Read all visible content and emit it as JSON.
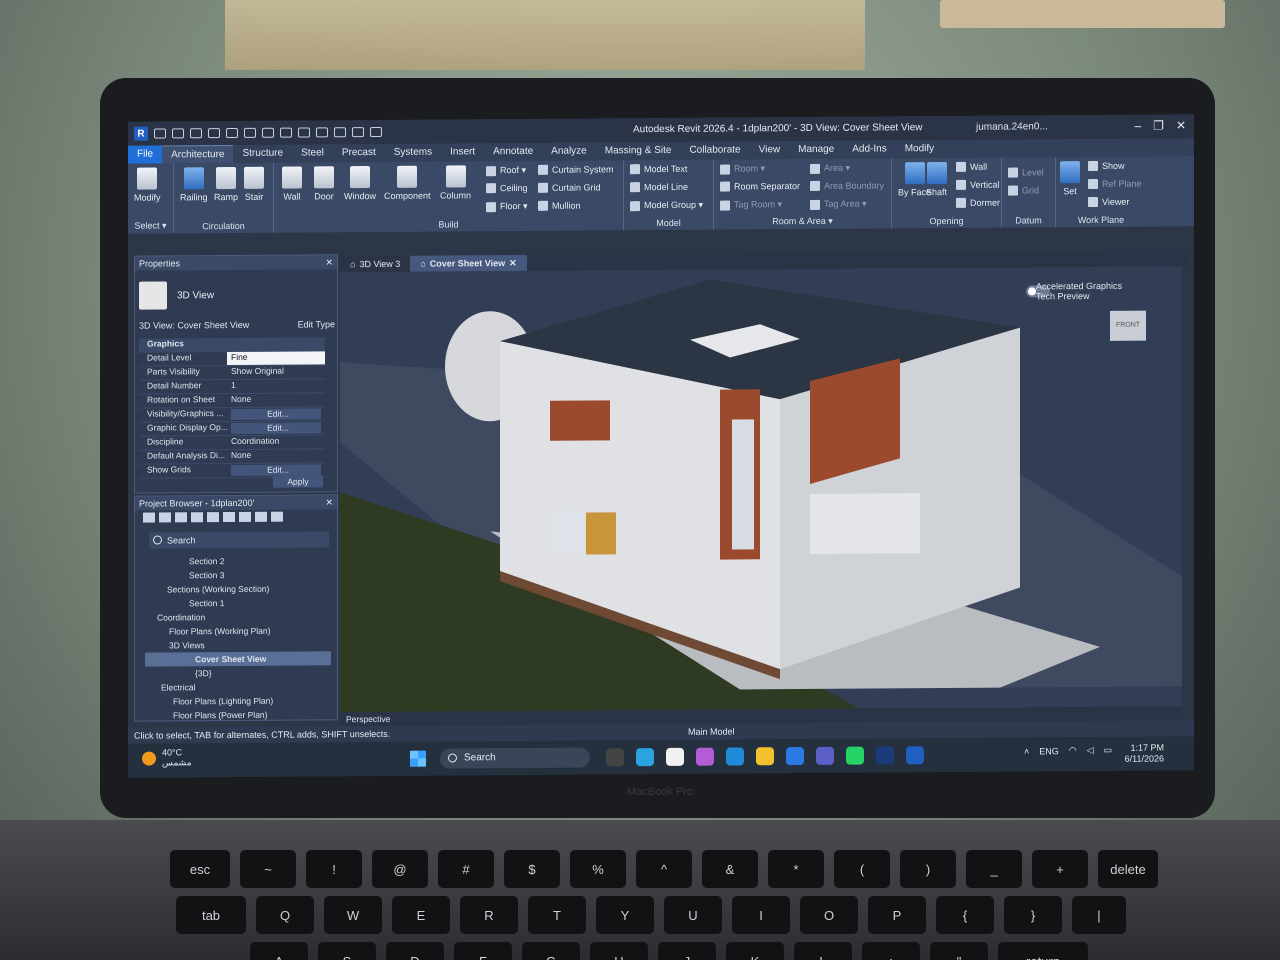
{
  "window": {
    "title": "Autodesk Revit 2026.4 - 1dplan200' - 3D View: Cover Sheet View",
    "user": "jumana.24en0...",
    "min": "–",
    "max": "❐",
    "close": "✕"
  },
  "ribbon_tabs": [
    "File",
    "Architecture",
    "Structure",
    "Steel",
    "Precast",
    "Systems",
    "Insert",
    "Annotate",
    "Analyze",
    "Massing & Site",
    "Collaborate",
    "View",
    "Manage",
    "Add-Ins",
    "Modify"
  ],
  "ribbon": {
    "select": {
      "modify": "Modify",
      "title": "Select ▾"
    },
    "build": {
      "title": "Build",
      "wall": "Wall",
      "door": "Door",
      "window": "Window",
      "component": "Component",
      "column": "Column",
      "roof": "Roof ▾",
      "ceiling": "Ceiling",
      "floor": "Floor ▾",
      "curtain_system": "Curtain System",
      "curtain_grid": "Curtain Grid",
      "mullion": "Mullion"
    },
    "circulation": {
      "title": "Circulation",
      "railing": "Railing",
      "ramp": "Ramp",
      "stair": "Stair"
    },
    "model": {
      "title": "Model",
      "text": "Model Text",
      "line": "Model Line",
      "group": "Model Group ▾"
    },
    "room_area": {
      "title": "Room & Area ▾",
      "room": "Room ▾",
      "separator": "Room Separator",
      "tag_room": "Tag Room ▾",
      "area": "Area ▾",
      "area_boundary": "Area Boundary",
      "tag_area": "Tag Area ▾"
    },
    "opening": {
      "title": "Opening",
      "by_face": "By Face",
      "shaft": "Shaft",
      "wall": "Wall",
      "vertical": "Vertical",
      "dormer": "Dormer"
    },
    "datum": {
      "title": "Datum",
      "level": "Level",
      "grid": "Grid"
    },
    "work_plane": {
      "title": "Work Plane",
      "set": "Set",
      "show": "Show",
      "ref_plane": "Ref Plane",
      "viewer": "Viewer"
    }
  },
  "properties": {
    "header": "Properties",
    "type": "3D View",
    "view_name": "3D View: Cover Sheet View",
    "edit_type": "Edit Type",
    "rows": [
      {
        "k": "Graphics",
        "v": ""
      },
      {
        "k": "Detail Level",
        "v": "Fine"
      },
      {
        "k": "Parts Visibility",
        "v": "Show Original"
      },
      {
        "k": "Detail Number",
        "v": "1"
      },
      {
        "k": "Rotation on Sheet",
        "v": "None"
      },
      {
        "k": "Visibility/Graphics ...",
        "v": "Edit..."
      },
      {
        "k": "Graphic Display Op...",
        "v": "Edit..."
      },
      {
        "k": "Discipline",
        "v": "Coordination"
      },
      {
        "k": "Default Analysis Di...",
        "v": "None"
      },
      {
        "k": "Show Grids",
        "v": "Edit..."
      }
    ],
    "apply": "Apply"
  },
  "project_browser": {
    "header": "Project Browser - 1dplan200'",
    "search_placeholder": "Search",
    "items": [
      "Section 2",
      "Section 3",
      "Sections (Working Section)",
      "Section 1",
      "Coordination",
      "Floor Plans (Working Plan)",
      "3D Views",
      "Cover Sheet View",
      "{3D}",
      "Electrical",
      "Floor Plans (Lighting Plan)",
      "Floor Plans (Power Plan)"
    ]
  },
  "view_tabs": [
    "3D View 3",
    "Cover Sheet View"
  ],
  "viewport": {
    "hud_line1": "Accelerated Graphics",
    "hud_line2": "Tech Preview",
    "viewcube": "FRONT"
  },
  "view_control": {
    "mode": "Perspective"
  },
  "status": {
    "hint": "Click to select, TAB for alternates, CTRL adds, SHIFT unselects.",
    "model": "Main Model"
  },
  "taskbar": {
    "temp": "40°C",
    "weather": "مشمس",
    "search": "Search",
    "lang": "ENG",
    "time": "1:17 PM",
    "date": "6/11/2026"
  },
  "bezel": "MacBook Pro",
  "keys_row1": [
    "esc",
    "~",
    "!",
    "@",
    "#",
    "$",
    "%",
    "^",
    "&",
    "*",
    "(",
    ")",
    "_",
    "+",
    "delete"
  ],
  "keys_row2": [
    "tab",
    "Q",
    "W",
    "E",
    "R",
    "T",
    "Y",
    "U",
    "I",
    "O",
    "P",
    "{",
    "}",
    "|"
  ],
  "keys_row3": [
    "A",
    "S",
    "D",
    "F",
    "G",
    "H",
    "J",
    "K",
    "L",
    ":",
    "\"",
    "return"
  ],
  "colors": {
    "accent": "#1f6fd6",
    "ribbon": "#3a4a66",
    "canvas": "#323e56",
    "brick": "#9b4a2e",
    "grass": "#2e3a22"
  }
}
